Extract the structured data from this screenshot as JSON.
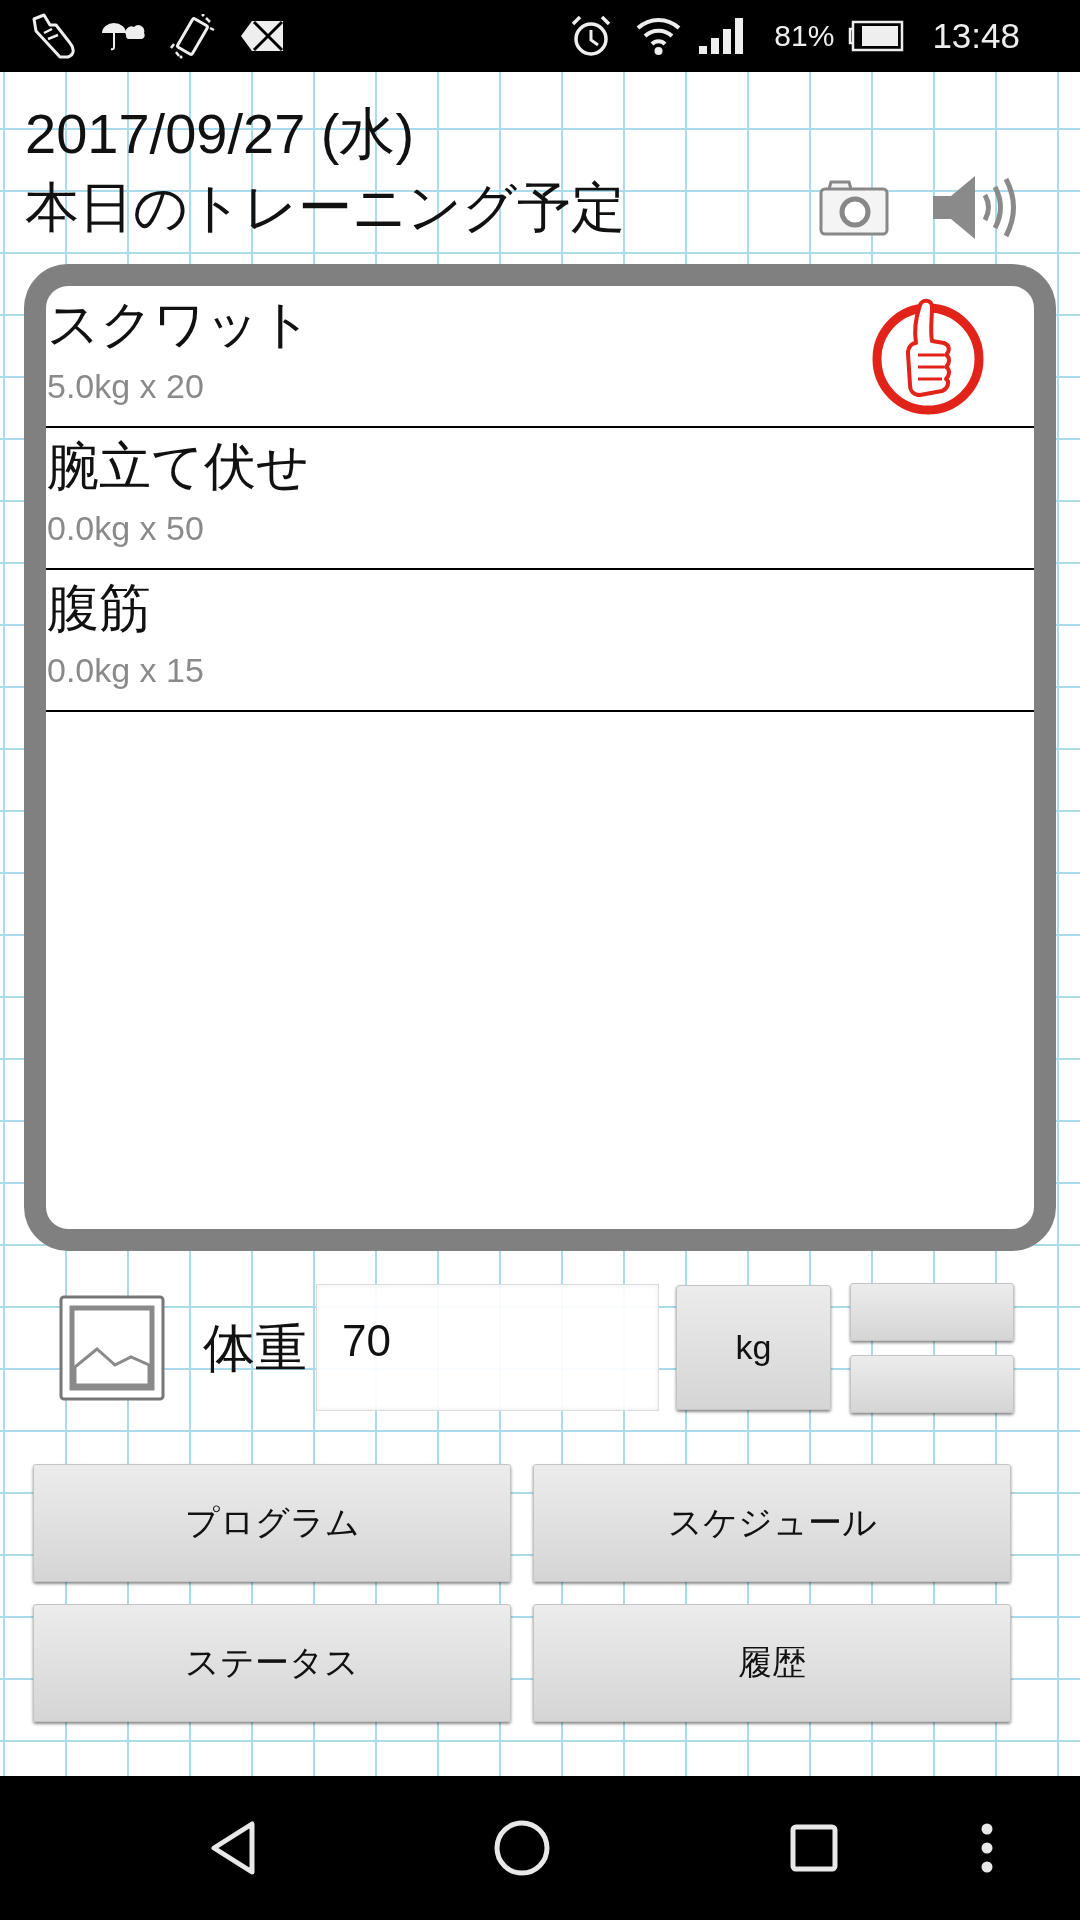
{
  "status_bar": {
    "battery": "81%",
    "time": "13:48"
  },
  "header": {
    "date": "2017/09/27 (水)",
    "title": "本日のトレーニング予定"
  },
  "schedule": {
    "items": [
      {
        "name": "スクワット",
        "detail": "5.0kg x 20",
        "done": true
      },
      {
        "name": "腕立て伏せ",
        "detail": "0.0kg x 50",
        "done": false
      },
      {
        "name": "腹筋",
        "detail": "0.0kg x 15",
        "done": false
      }
    ]
  },
  "weight": {
    "label": "体重",
    "value": "70",
    "unit": "kg"
  },
  "buttons": [
    "プログラム",
    "スケジュール",
    "ステータス",
    "履歴"
  ]
}
